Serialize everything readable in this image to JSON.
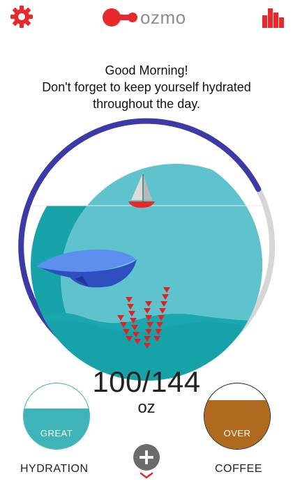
{
  "header": {
    "logo_text": "ozmo",
    "settings_icon": "gear-icon",
    "stats_icon": "bar-chart-icon",
    "accent_color": "#e8282b"
  },
  "greeting": {
    "line1": "Good Morning!",
    "line2": "Don't forget to keep yourself hydrated",
    "line3": "throughout the day."
  },
  "progress": {
    "current": "100",
    "goal": "144",
    "display": "100/144",
    "unit": "oz",
    "ring_fraction": 0.69,
    "ring_color": "#3b3aa6",
    "track_color": "#d6d6d6"
  },
  "gauges": {
    "hydration": {
      "status": "GREAT",
      "label": "HYDRATION",
      "fill": 0.62,
      "color": "#3eb3b8"
    },
    "coffee": {
      "status": "OVER",
      "label": "COFFEE",
      "fill": 0.74,
      "color": "#b06a1d"
    }
  },
  "actions": {
    "add_icon": "plus-icon",
    "expand_icon": "chevron-down-icon"
  }
}
